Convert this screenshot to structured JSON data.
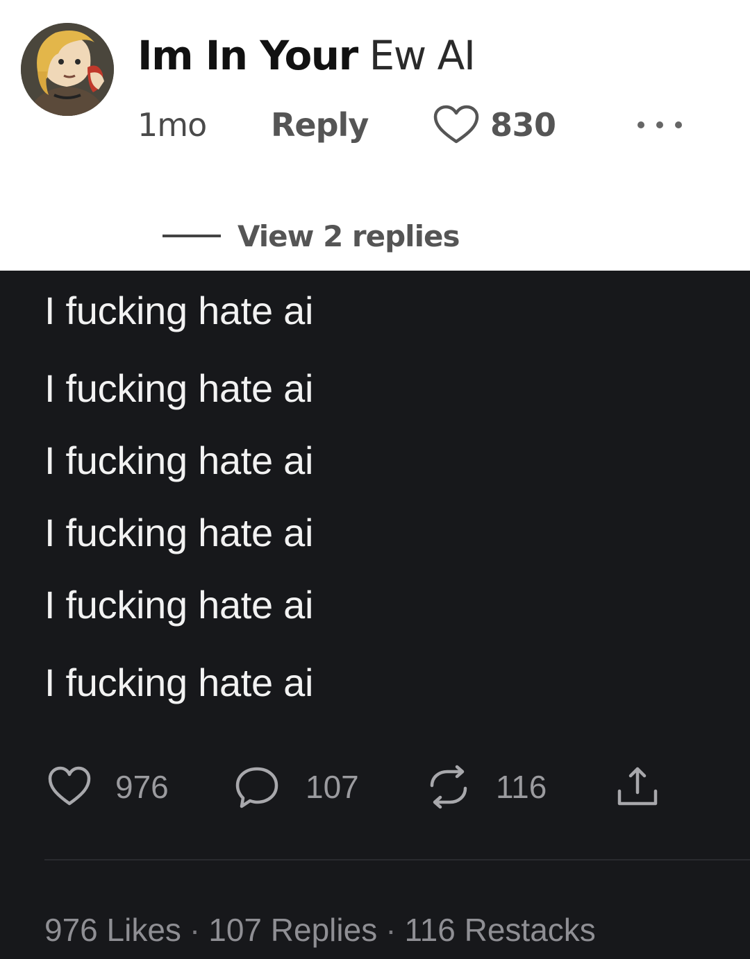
{
  "comment": {
    "author_bold": "Im In Your",
    "author_light": "Ew AI",
    "time": "1mo",
    "reply_label": "Reply",
    "like_count": "830",
    "view_replies": "View 2 replies"
  },
  "post": {
    "lines": [
      "I fucking hate ai",
      "I fucking hate ai",
      "I fucking hate ai",
      "I fucking hate ai",
      "I fucking hate ai",
      "I fucking hate ai"
    ],
    "actions": {
      "likes": "976",
      "replies": "107",
      "restacks": "116"
    },
    "summary": {
      "likes": "976 Likes",
      "replies": "107 Replies",
      "restacks": "116 Restacks",
      "separator": "·"
    }
  },
  "colors": {
    "dark_background": "#17181b",
    "post_text": "#f2f2f2",
    "muted_text": "#9b9b9f"
  },
  "icons": [
    "avatar",
    "heart-icon",
    "more-icon",
    "comment-icon",
    "restack-icon",
    "share-icon"
  ]
}
